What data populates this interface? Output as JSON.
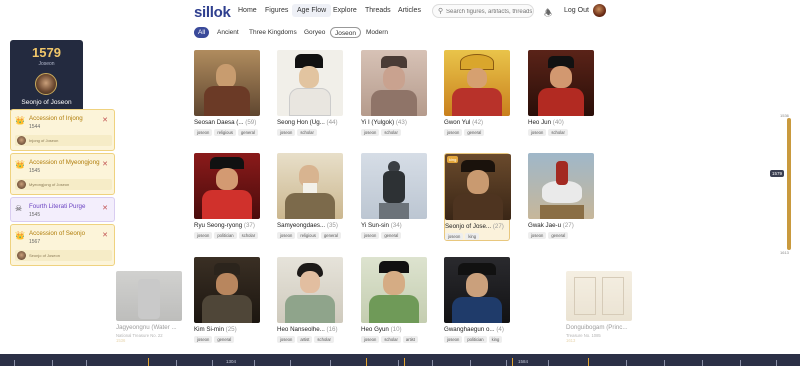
{
  "header": {
    "logo": "sillok",
    "nav": [
      "Home",
      "Figures",
      "Age Flow",
      "Explore",
      "Threads",
      "Articles"
    ],
    "active_nav": "Age Flow",
    "search_placeholder": "Search figures, artifacts, threads",
    "logout": "Log Out"
  },
  "filters": [
    "All",
    "Ancient",
    "Three Kingdoms",
    "Goryeo",
    "Joseon",
    "Modern"
  ],
  "current": {
    "year": "1579",
    "era": "Joseon",
    "name": "Seonjo of Joseon"
  },
  "events": [
    {
      "title": "Accession of Injong",
      "year": "1544",
      "ref": "Injong of Joseon",
      "icon": "crown-icon"
    },
    {
      "title": "Accession of Myeongjong",
      "year": "1545",
      "ref": "Myeongjong of Joseon",
      "icon": "crown-icon"
    },
    {
      "title": "Fourth Literati Purge",
      "year": "1545",
      "ref": "",
      "icon": "skull-icon"
    },
    {
      "title": "Accession of Seonjo",
      "year": "1567",
      "ref": "Seonjo of Joseon",
      "icon": "crown-icon"
    }
  ],
  "cards": [
    {
      "name": "Seosan Daesa (...",
      "count": "(59)",
      "tags": [
        "joseon",
        "religious",
        "general"
      ]
    },
    {
      "name": "Seong Hon (Ug...",
      "count": "(44)",
      "tags": [
        "joseon",
        "scholar"
      ]
    },
    {
      "name": "Yi I (Yulgok)",
      "count": "(43)",
      "tags": [
        "joseon",
        "scholar"
      ]
    },
    {
      "name": "Gwon Yul",
      "count": "(42)",
      "tags": [
        "joseon",
        "general"
      ]
    },
    {
      "name": "Heo Jun",
      "count": "(40)",
      "tags": [
        "joseon",
        "scholar"
      ]
    },
    {
      "name": "Ryu Seong-ryong",
      "count": "(37)",
      "tags": [
        "joseon",
        "politician",
        "scholar"
      ]
    },
    {
      "name": "Samyeongdaes...",
      "count": "(35)",
      "tags": [
        "joseon",
        "religious",
        "general"
      ]
    },
    {
      "name": "Yi Sun-sin",
      "count": "(34)",
      "tags": [
        "joseon",
        "general"
      ]
    },
    {
      "name": "Seonjo of Jose...",
      "count": "(27)",
      "tags": [
        "joseon",
        "king"
      ],
      "badge": "king"
    },
    {
      "name": "Gwak Jae-u",
      "count": "(27)",
      "tags": [
        "joseon",
        "general"
      ]
    },
    {
      "name": "Kim Si-min",
      "count": "(25)",
      "tags": [
        "joseon",
        "general"
      ]
    },
    {
      "name": "Heo Nanseolhe...",
      "count": "(16)",
      "tags": [
        "joseon",
        "artist",
        "scholar"
      ]
    },
    {
      "name": "Heo Gyun",
      "count": "(10)",
      "tags": [
        "joseon",
        "scholar",
        "artist"
      ]
    },
    {
      "name": "Gwanghaegun o...",
      "count": "(4)",
      "tags": [
        "joseon",
        "politician",
        "king"
      ]
    }
  ],
  "artifacts": [
    {
      "name": "Jagyeongnu (Water ...",
      "sub": "National Treasure No. 22",
      "year": "1536"
    },
    {
      "name": "Donguibogam (Princ...",
      "sub": "Treasure No. 1085",
      "year": "1613"
    }
  ],
  "right_timeline": {
    "top": "1536",
    "marker": "1579",
    "bottom": "1613"
  },
  "bottom_timeline": {
    "labels": [
      "1304",
      "1584"
    ]
  },
  "colors": {
    "brand": "#2f3f8f",
    "accent": "#e4a42f",
    "panel": "#232a3f"
  }
}
